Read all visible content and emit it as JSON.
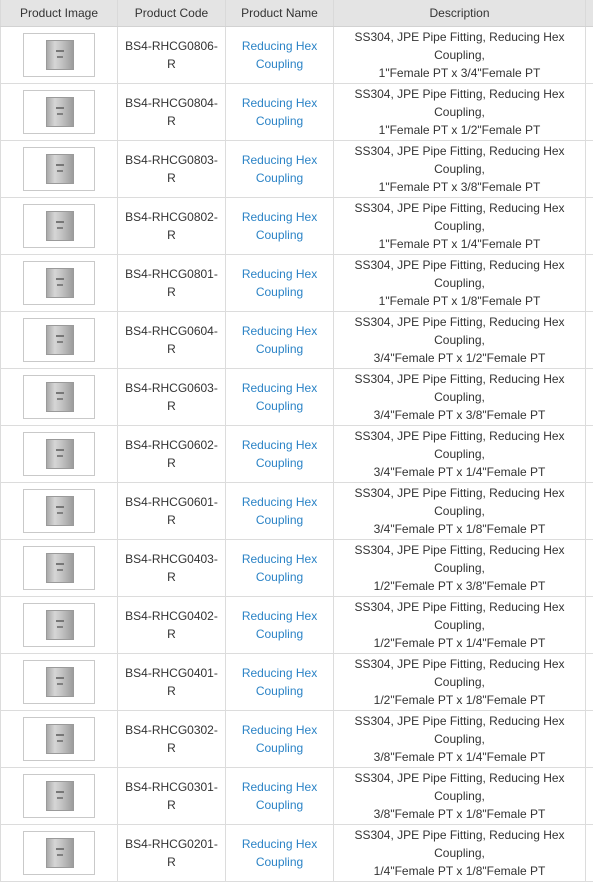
{
  "headers": {
    "image": "Product Image",
    "code": "Product Code",
    "name": "Product Name",
    "description": "Description"
  },
  "icons": {
    "thumbnail": "pipe-fitting-thumbnail-icon"
  },
  "colors": {
    "header_bg": "#e4e4e4",
    "link": "#2b83c6",
    "border": "#dcdcdc"
  },
  "rows": [
    {
      "code": "BS4-RHCG0806-R",
      "name": "Reducing Hex Coupling",
      "desc_line1": "SS304, JPE Pipe Fitting, Reducing Hex Coupling,",
      "desc_line2": "1\"Female PT x 3/4\"Female PT"
    },
    {
      "code": "BS4-RHCG0804-R",
      "name": "Reducing Hex Coupling",
      "desc_line1": "SS304, JPE Pipe Fitting, Reducing Hex Coupling,",
      "desc_line2": "1\"Female PT x 1/2\"Female PT"
    },
    {
      "code": "BS4-RHCG0803-R",
      "name": "Reducing Hex Coupling",
      "desc_line1": "SS304, JPE Pipe Fitting, Reducing Hex Coupling,",
      "desc_line2": "1\"Female PT x 3/8\"Female PT"
    },
    {
      "code": "BS4-RHCG0802-R",
      "name": "Reducing Hex Coupling",
      "desc_line1": "SS304, JPE Pipe Fitting, Reducing Hex Coupling,",
      "desc_line2": "1\"Female PT x 1/4\"Female PT"
    },
    {
      "code": "BS4-RHCG0801-R",
      "name": "Reducing Hex Coupling",
      "desc_line1": "SS304, JPE Pipe Fitting, Reducing Hex Coupling,",
      "desc_line2": "1\"Female PT x 1/8\"Female PT"
    },
    {
      "code": "BS4-RHCG0604-R",
      "name": "Reducing Hex Coupling",
      "desc_line1": "SS304, JPE Pipe Fitting, Reducing Hex Coupling,",
      "desc_line2": "3/4\"Female PT x 1/2\"Female PT"
    },
    {
      "code": "BS4-RHCG0603-R",
      "name": "Reducing Hex Coupling",
      "desc_line1": "SS304, JPE Pipe Fitting, Reducing Hex Coupling,",
      "desc_line2": "3/4\"Female PT x 3/8\"Female PT"
    },
    {
      "code": "BS4-RHCG0602-R",
      "name": "Reducing Hex Coupling",
      "desc_line1": "SS304, JPE Pipe Fitting, Reducing Hex Coupling,",
      "desc_line2": "3/4\"Female PT x 1/4\"Female PT"
    },
    {
      "code": "BS4-RHCG0601-R",
      "name": "Reducing Hex Coupling",
      "desc_line1": "SS304, JPE Pipe Fitting, Reducing Hex Coupling,",
      "desc_line2": "3/4\"Female PT x 1/8\"Female PT"
    },
    {
      "code": "BS4-RHCG0403-R",
      "name": "Reducing Hex Coupling",
      "desc_line1": "SS304, JPE Pipe Fitting, Reducing Hex Coupling,",
      "desc_line2": "1/2\"Female PT x 3/8\"Female PT"
    },
    {
      "code": "BS4-RHCG0402-R",
      "name": "Reducing Hex Coupling",
      "desc_line1": "SS304, JPE Pipe Fitting, Reducing Hex Coupling,",
      "desc_line2": "1/2\"Female PT x 1/4\"Female PT"
    },
    {
      "code": "BS4-RHCG0401-R",
      "name": "Reducing Hex Coupling",
      "desc_line1": "SS304, JPE Pipe Fitting, Reducing Hex Coupling,",
      "desc_line2": "1/2\"Female PT x 1/8\"Female PT"
    },
    {
      "code": "BS4-RHCG0302-R",
      "name": "Reducing Hex Coupling",
      "desc_line1": "SS304, JPE Pipe Fitting, Reducing Hex Coupling,",
      "desc_line2": "3/8\"Female PT x 1/4\"Female PT"
    },
    {
      "code": "BS4-RHCG0301-R",
      "name": "Reducing Hex Coupling",
      "desc_line1": "SS304, JPE Pipe Fitting, Reducing Hex Coupling,",
      "desc_line2": "3/8\"Female PT x 1/8\"Female PT"
    },
    {
      "code": "BS4-RHCG0201-R",
      "name": "Reducing Hex Coupling",
      "desc_line1": "SS304, JPE Pipe Fitting, Reducing Hex Coupling,",
      "desc_line2": "1/4\"Female PT x 1/8\"Female PT"
    }
  ]
}
